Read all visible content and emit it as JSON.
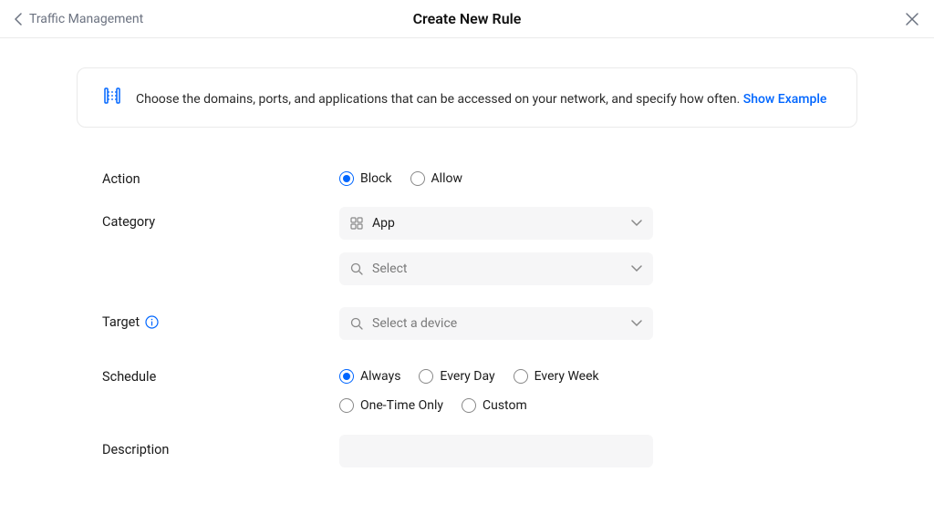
{
  "header": {
    "back_label": "Traffic Management",
    "title": "Create New Rule"
  },
  "info": {
    "text": "Choose the domains, ports, and applications that can be accessed on your network, and specify how often. ",
    "link_label": "Show Example"
  },
  "labels": {
    "action": "Action",
    "category": "Category",
    "target": "Target",
    "schedule": "Schedule",
    "description": "Description"
  },
  "action_options": {
    "block": "Block",
    "allow": "Allow"
  },
  "category": {
    "selected": "App",
    "select_placeholder": "Select"
  },
  "target": {
    "placeholder": "Select a device"
  },
  "schedule_options": {
    "always": "Always",
    "every_day": "Every Day",
    "every_week": "Every Week",
    "one_time": "One-Time Only",
    "custom": "Custom"
  },
  "description_value": ""
}
